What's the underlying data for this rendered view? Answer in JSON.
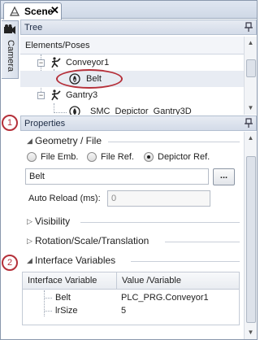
{
  "tab": {
    "title": "Scene",
    "close": "✕"
  },
  "side_tab": {
    "label": "Camera"
  },
  "tree_panel": {
    "title": "Tree",
    "column_header": "Elements/Poses",
    "items": [
      {
        "label": "Conveyor1",
        "expander": "−"
      },
      {
        "label": "Belt"
      },
      {
        "label": "Gantry3",
        "expander": "−"
      },
      {
        "label": "SMC_Depictor_Gantry3D"
      }
    ]
  },
  "properties_panel": {
    "title": "Properties",
    "geometry": {
      "title": "Geometry / File",
      "options": [
        "File Emb.",
        "File Ref.",
        "Depictor Ref."
      ],
      "selected": "Depictor Ref.",
      "value": "Belt",
      "browse_label": "...",
      "auto_reload_label": "Auto Reload (ms):",
      "auto_reload_value": "0"
    },
    "sections": [
      "Visibility",
      "Rotation/Scale/Translation"
    ],
    "interface_variables": {
      "title": "Interface Variables",
      "columns": [
        "Interface Variable",
        "Value /Variable"
      ],
      "rows": [
        {
          "name": "Belt",
          "value": "PLC_PRG.Conveyor1"
        },
        {
          "name": "lrSize",
          "value": "5"
        }
      ]
    }
  },
  "callouts": [
    "1",
    "2"
  ],
  "colors": {
    "accent_red": "#b5303a",
    "header_blue": "#d3dbe8",
    "border": "#8a98ad"
  }
}
